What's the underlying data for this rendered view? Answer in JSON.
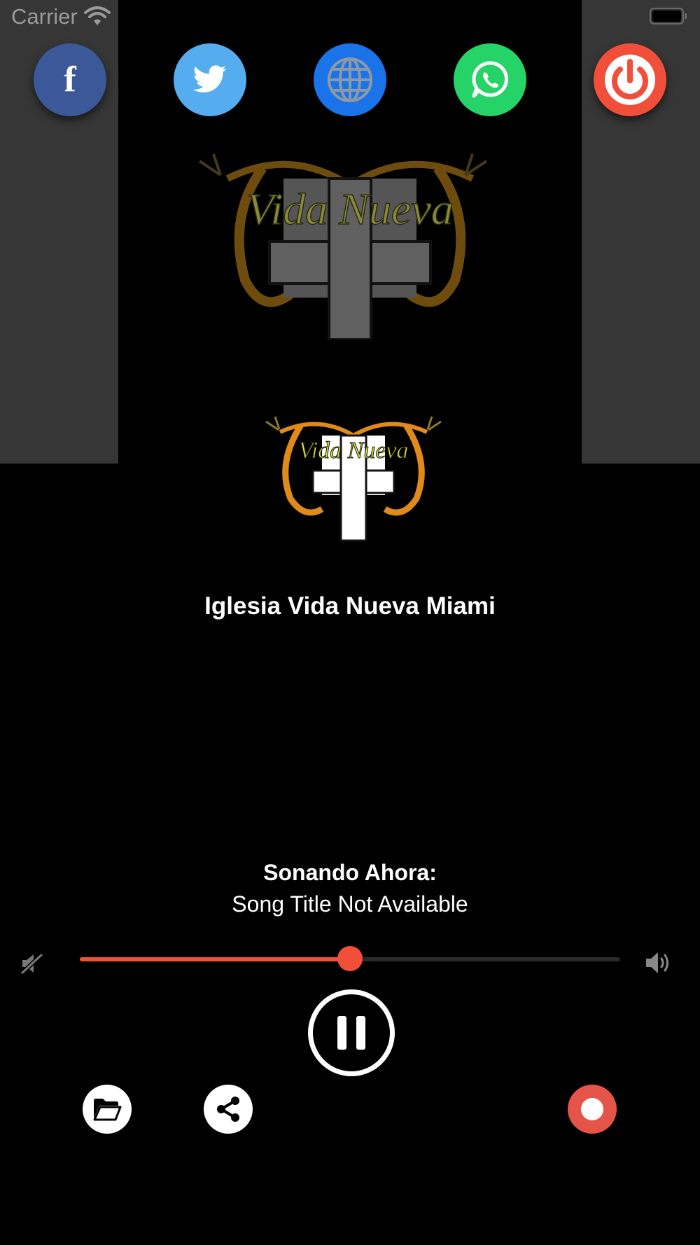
{
  "status_bar": {
    "carrier": "Carrier"
  },
  "social": {
    "facebook": {
      "glyph": "f",
      "color": "#3b5998"
    },
    "twitter": {
      "color": "#55acee"
    },
    "website": {
      "color": "#1a73e8"
    },
    "whatsapp": {
      "color": "#25d366"
    },
    "power": {
      "color": "#f24f3a"
    }
  },
  "logo": {
    "text": "Vida Nueva"
  },
  "station": {
    "name": "Iglesia Vida Nueva Miami"
  },
  "now_playing": {
    "label": "Sonando Ahora:",
    "title": "Song Title Not Available"
  },
  "volume": {
    "level": 0.5
  },
  "colors": {
    "accent": "#f24f3a",
    "background": "#000000",
    "hero_side": "#363636"
  },
  "icons": [
    "facebook-icon",
    "twitter-icon",
    "globe-icon",
    "whatsapp-icon",
    "power-icon",
    "volume-mute-icon",
    "volume-up-icon",
    "pause-icon",
    "folder-icon",
    "share-icon",
    "record-icon"
  ]
}
